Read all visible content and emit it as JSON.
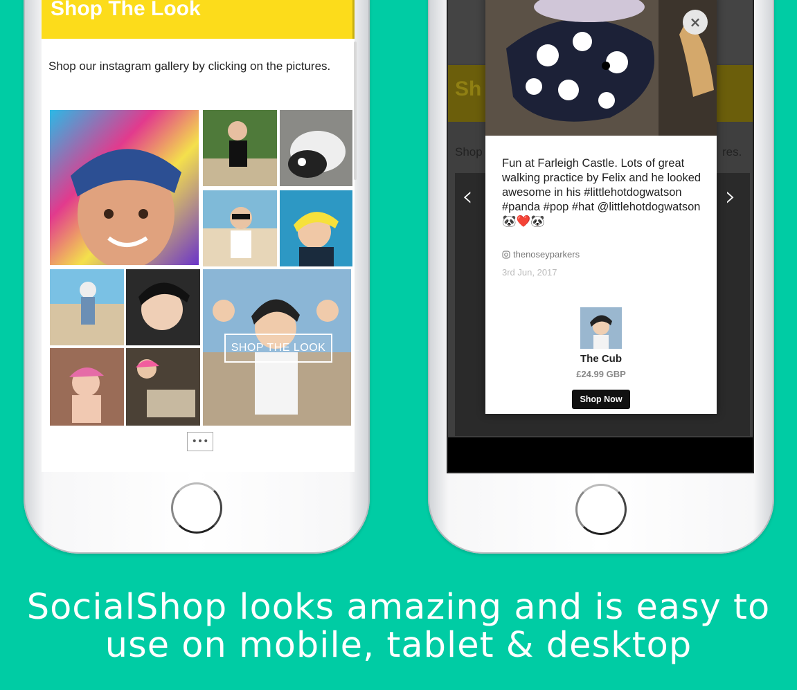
{
  "left_phone": {
    "banner_title": "Shop The Look",
    "intro_text": "Shop our instagram gallery by clicking on the pictures.",
    "cta_label": "SHOP THE LOOK",
    "more_label": "•••"
  },
  "right_phone": {
    "background_intro_left": "Shop",
    "background_intro_right": "res.",
    "background_banner_fragment": "Sh",
    "prev_arrow": "‹",
    "next_arrow": "›",
    "modal": {
      "close_label": "×",
      "caption": "Fun at Farleigh Castle. Lots of great walking practice by Felix and he looked awesome in his #littlehotdogwatson #panda #pop #hat @littlehotdogwatson 🐼❤️🐼",
      "instagram_user": "thenoseyparkers",
      "post_date": "3rd Jun, 2017",
      "product_name": "The Cub",
      "product_price": "£24.99 GBP",
      "shop_now_label": "Shop Now"
    }
  },
  "tagline": {
    "line1": "SocialShop looks amazing and is easy to",
    "line2": "use on mobile, tablet & desktop"
  },
  "colors": {
    "background": "#00cca4",
    "banner": "#fcdc1b",
    "shop_now": "#111111"
  }
}
